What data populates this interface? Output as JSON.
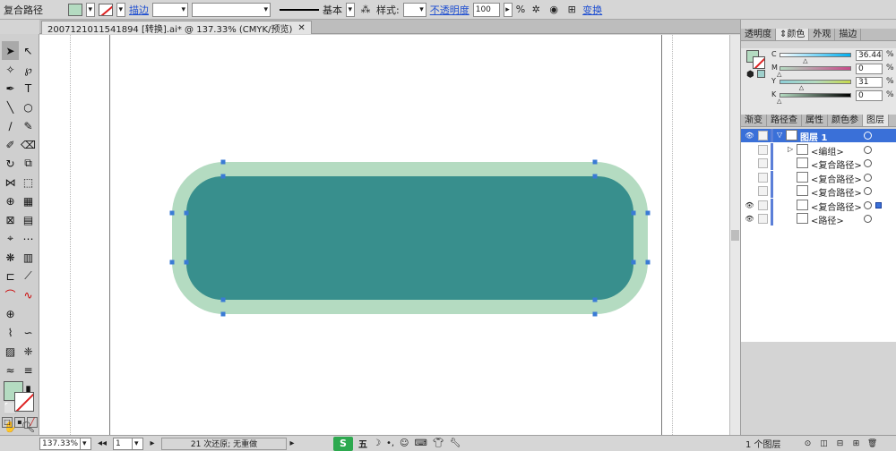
{
  "control_bar": {
    "selection_type": "复合路径",
    "stroke_link": "描边",
    "stroke_profile": "基本",
    "style_label": "样式:",
    "opacity_link": "不透明度",
    "opacity_value": "100",
    "opacity_unit": "%",
    "transform_link": "变换"
  },
  "document_tab": {
    "title": "2007121011541894 [转换].ai* @ 137.33% (CMYK/预览)",
    "close": "✕"
  },
  "color_panel": {
    "tabs": [
      "透明度",
      "⇕颜色",
      "外观",
      "描边"
    ],
    "active_tab": 1,
    "channels": [
      {
        "name": "C",
        "value": "36.44",
        "fraction": 0.3644
      },
      {
        "name": "M",
        "value": "0",
        "fraction": 0
      },
      {
        "name": "Y",
        "value": "31",
        "fraction": 0.31
      },
      {
        "name": "K",
        "value": "0",
        "fraction": 0
      }
    ],
    "unit": "%",
    "fill_color": "#b4dbc1"
  },
  "layers_panel": {
    "tabs": [
      "渐变",
      "路径查",
      "属性",
      "颜色参",
      "图层"
    ],
    "active_tab": 4,
    "rows": [
      {
        "name": "图层 1",
        "visible": true
      },
      {
        "name": "<编组>",
        "visible": false
      },
      {
        "name": "<复合路径>",
        "visible": false
      },
      {
        "name": "<复合路径>",
        "visible": false
      },
      {
        "name": "<复合路径>",
        "visible": false
      },
      {
        "name": "<复合路径>",
        "visible": true
      },
      {
        "name": "<路径>",
        "visible": true
      }
    ],
    "layer_count": "1 个图层"
  },
  "status_bar": {
    "zoom": "137.33%",
    "page": "1",
    "history": "21 次还原; 无重做"
  },
  "ime_bar": {
    "mode": "五"
  },
  "artwork": {
    "outer_color": "#b4dbc1",
    "inner_color": "#388f8d"
  }
}
